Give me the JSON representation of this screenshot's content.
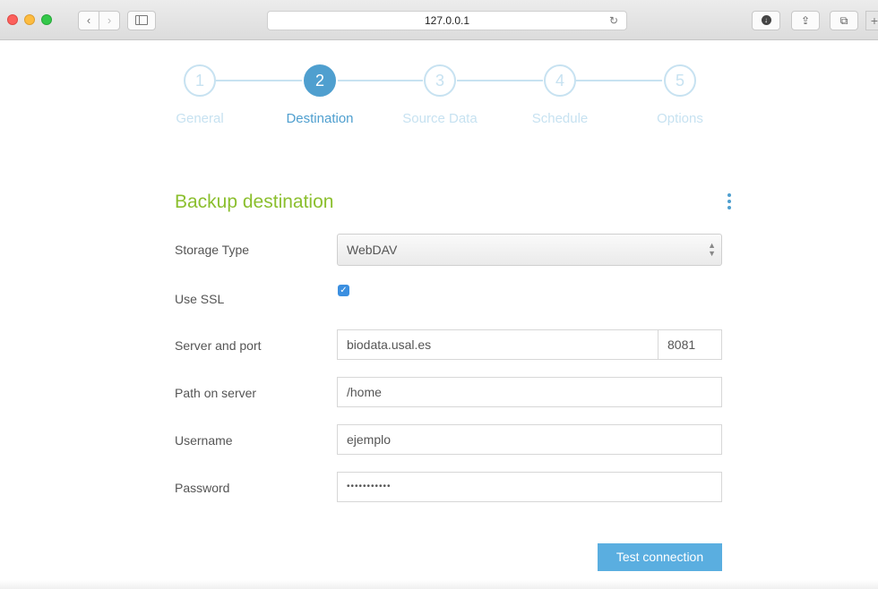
{
  "browser": {
    "url": "127.0.0.1",
    "back_glyph": "‹",
    "forward_glyph": "›",
    "reload_glyph": "↻",
    "share_glyph": "⇪",
    "tabs_glyph": "⧉",
    "download_glyph": "↓",
    "newtab_glyph": "+"
  },
  "wizard": {
    "steps": [
      {
        "number": "1",
        "label": "General",
        "active": false
      },
      {
        "number": "2",
        "label": "Destination",
        "active": true
      },
      {
        "number": "3",
        "label": "Source Data",
        "active": false
      },
      {
        "number": "4",
        "label": "Schedule",
        "active": false
      },
      {
        "number": "5",
        "label": "Options",
        "active": false
      }
    ],
    "active_color": "#4f9fcf",
    "inactive_color": "#c7e2f1"
  },
  "form": {
    "title": "Backup destination",
    "title_color": "#8bbf2e",
    "menu_icon": "kebab-menu-icon",
    "storage_type": {
      "label": "Storage Type",
      "value": "WebDAV"
    },
    "use_ssl": {
      "label": "Use SSL",
      "checked": true,
      "check_glyph": "✓"
    },
    "server": {
      "label": "Server and port",
      "host": "biodata.usal.es",
      "port": "8081"
    },
    "path": {
      "label": "Path on server",
      "value": "/home"
    },
    "username": {
      "label": "Username",
      "value": "ejemplo"
    },
    "password": {
      "label": "Password",
      "value": "•••••••••••"
    },
    "test_button": "Test connection"
  }
}
